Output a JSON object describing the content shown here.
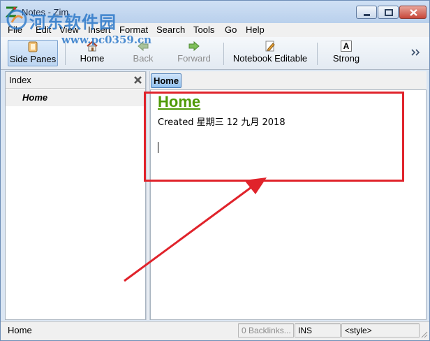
{
  "window": {
    "title": "Notes - Zim"
  },
  "menu": {
    "items": [
      {
        "label": "File"
      },
      {
        "label": "Edit"
      },
      {
        "label": "View"
      },
      {
        "label": "Insert"
      },
      {
        "label": "Format"
      },
      {
        "label": "Search"
      },
      {
        "label": "Tools"
      },
      {
        "label": "Go"
      },
      {
        "label": "Help"
      }
    ]
  },
  "watermark": {
    "line1": "河东软件园",
    "line2": "www.pc0359.cn"
  },
  "toolbar": {
    "side_panes": "Side Panes",
    "home": "Home",
    "back": "Back",
    "forward": "Forward",
    "notebook_editable": "Notebook Editable",
    "strong": "Strong",
    "strong_glyph": "A"
  },
  "index": {
    "title": "Index",
    "items": [
      {
        "label": "Home"
      }
    ]
  },
  "pathbar": {
    "current": "Home"
  },
  "editor": {
    "heading": "Home",
    "created": "Created 星期三 12 九月 2018"
  },
  "statusbar": {
    "page": "Home",
    "backlinks": "0 Backlinks...",
    "mode": "INS",
    "style": "<style>"
  },
  "colors": {
    "heading": "#4e9a06",
    "annotation": "#e0232b",
    "watermark": "#2d79c9",
    "window_chrome": "#dbe6f3"
  },
  "icons": {
    "app": "zim-icon",
    "side_panes": "side-panes-icon",
    "home": "home-icon",
    "back": "back-arrow-icon",
    "forward": "forward-arrow-icon",
    "notebook_editable": "edit-pencil-icon",
    "strong": "bold-icon",
    "close_index": "close-icon"
  }
}
